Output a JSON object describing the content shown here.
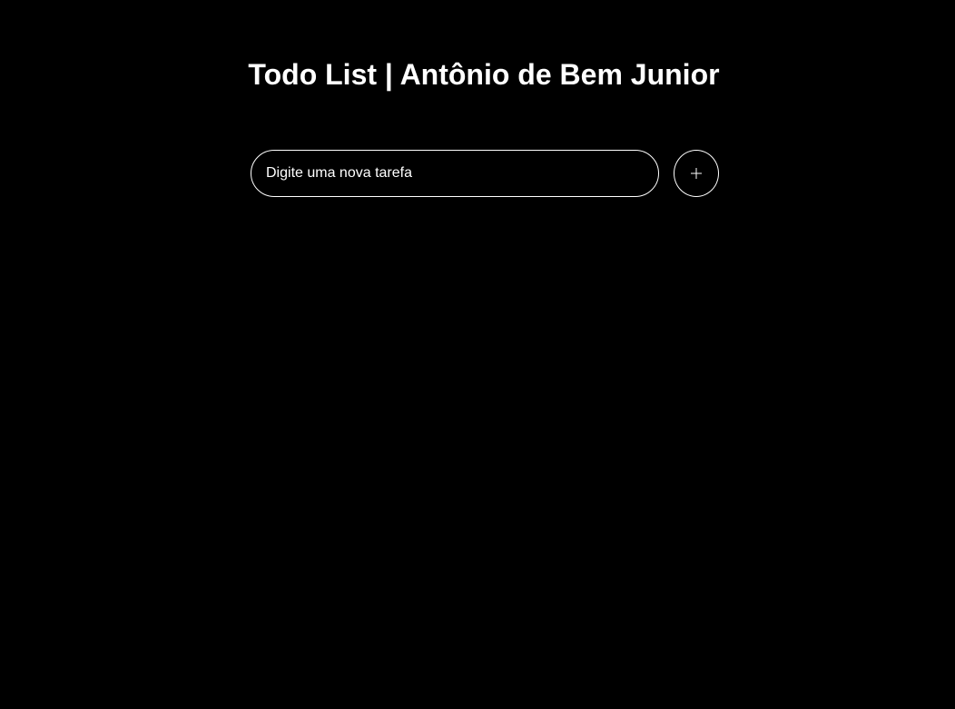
{
  "header": {
    "title": "Todo List | Antônio de Bem Junior"
  },
  "form": {
    "input_placeholder": "Digite uma nova tarefa",
    "input_value": "",
    "add_button_icon": "plus-icon"
  },
  "tasks": [],
  "colors": {
    "background": "#000000",
    "foreground": "#ffffff"
  }
}
